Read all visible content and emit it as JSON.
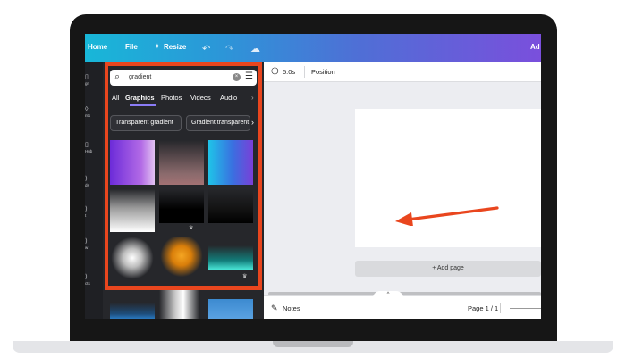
{
  "topbar": {
    "home_label": "Home",
    "file_label": "File",
    "resize_label": "Resize",
    "resize_icon": "sparkle-icon",
    "undo_icon": "undo-icon",
    "redo_icon": "redo-icon",
    "sync_icon": "cloud-check-icon",
    "right_label": "Ad"
  },
  "rail": {
    "items": [
      {
        "label": "gn"
      },
      {
        "label": "nts"
      },
      {
        "label": "Hub"
      },
      {
        "label": "ds"
      },
      {
        "label": "t"
      },
      {
        "label": "w"
      },
      {
        "label": "cts"
      }
    ]
  },
  "panel": {
    "search_value": "gradient",
    "tabs": [
      "All",
      "Graphics",
      "Photos",
      "Videos",
      "Audio"
    ],
    "active_tab": "Graphics",
    "chips": [
      "Transparent gradient",
      "Gradient transparent"
    ],
    "premium_marker": "♛"
  },
  "canvas": {
    "duration": "5.0s",
    "position_label": "Position",
    "add_page_label": "+ Add page",
    "notes_label": "Notes",
    "page_indicator": "Page 1 / 1"
  },
  "colors": {
    "highlight": "#e9461e",
    "arrow": "#e9461e",
    "accent_tab": "#8b7cf6"
  }
}
